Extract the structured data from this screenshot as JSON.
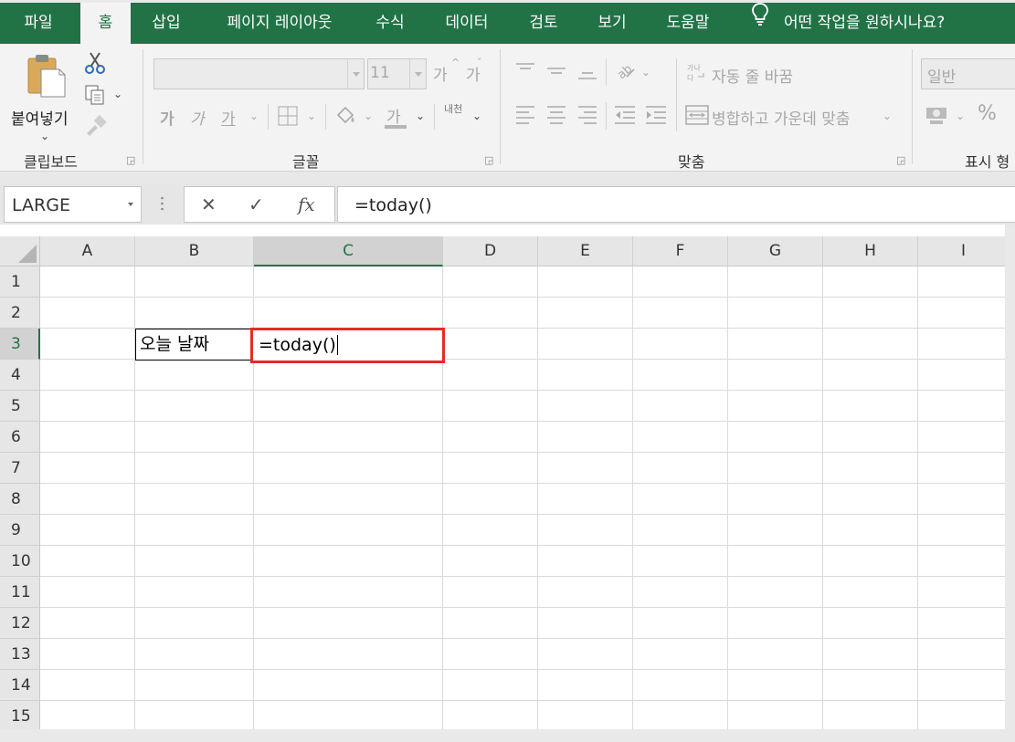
{
  "menu": {
    "tabs": [
      {
        "label": "파일"
      },
      {
        "label": "홈"
      },
      {
        "label": "삽입"
      },
      {
        "label": "페이지 레이아웃"
      },
      {
        "label": "수식"
      },
      {
        "label": "데이터"
      },
      {
        "label": "검토"
      },
      {
        "label": "보기"
      },
      {
        "label": "도움말"
      }
    ],
    "active_tab": "홈",
    "tell_me": "어떤 작업을 원하시나요?"
  },
  "ribbon": {
    "clipboard": {
      "paste_label": "붙여넣기",
      "group_label": "클립보드"
    },
    "font": {
      "font_size": "11",
      "increase_font": "가",
      "decrease_font": "가",
      "bold": "가",
      "italic": "가",
      "underline": "가",
      "font_color": "가",
      "phonetic_top": "내천",
      "phonetic_bottom": "",
      "group_label": "글꼴"
    },
    "alignment": {
      "wrap_text": "자동 줄 바꿈",
      "merge_center": "병합하고 가운데 맞춤",
      "group_label": "맞춤"
    },
    "number": {
      "format": "일반",
      "percent": "%",
      "group_label": "표시 형"
    }
  },
  "formula_bar": {
    "name_box": "LARGE",
    "cancel": "✕",
    "enter": "✓",
    "function": "fx",
    "content": "=today()"
  },
  "grid": {
    "columns": [
      "A",
      "B",
      "C",
      "D",
      "E",
      "F",
      "G",
      "H",
      "I"
    ],
    "rows": [
      "1",
      "2",
      "3",
      "4",
      "5",
      "6",
      "7",
      "8",
      "9",
      "10",
      "11",
      "12",
      "13",
      "14",
      "15"
    ],
    "selected_column": "C",
    "selected_row": "3",
    "cells": {
      "B3": "오늘 날짜",
      "C3": "=today()"
    }
  },
  "colors": {
    "excel_green": "#217346",
    "highlight_red": "#e52b2b"
  }
}
